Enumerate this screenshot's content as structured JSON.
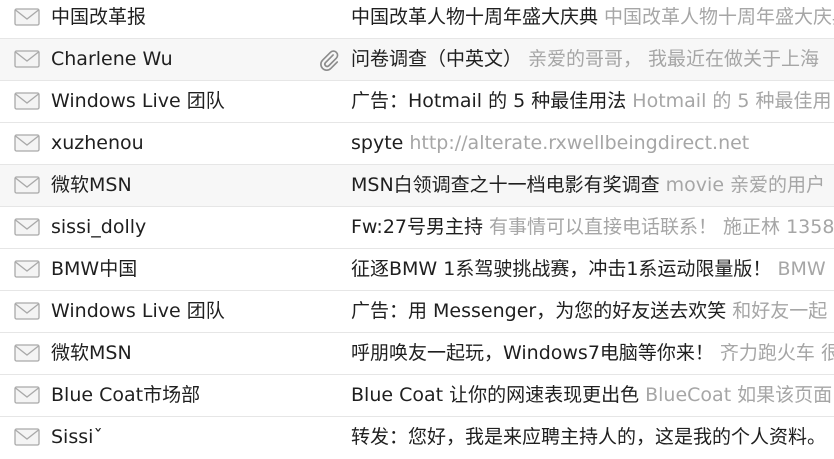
{
  "icons": {
    "envelope": "envelope-icon",
    "attachment": "paperclip-icon"
  },
  "colors": {
    "sender_text": "#1f1f1f",
    "preview_text": "#a6a6a6",
    "row_divider": "#e6e6e6"
  },
  "messages": [
    {
      "sender": "中国改革报",
      "subject": "中国改革人物十周年盛大庆典",
      "preview": "中国改革人物十周年盛大庆典",
      "has_attachment": false
    },
    {
      "sender": "Charlene Wu",
      "subject": "问卷调查（中英文）",
      "preview": "亲爱的哥哥， 我最近在做关于上海",
      "has_attachment": true
    },
    {
      "sender": "Windows Live 团队",
      "subject": "广告：Hotmail 的 5 种最佳用法",
      "preview": "Hotmail 的 5 种最佳用",
      "has_attachment": false
    },
    {
      "sender": "xuzhenou",
      "subject": "spyte",
      "preview": "http://alterate.rxwellbeingdirect.net",
      "has_attachment": false
    },
    {
      "sender": "微软MSN",
      "subject": "MSN白领调查之十一档电影有奖调查",
      "preview": "movie 亲爱的用户",
      "has_attachment": false
    },
    {
      "sender": "sissi_dolly",
      "subject": "Fw:27号男主持",
      "preview": "有事情可以直接电话联系！ 施正林 1358",
      "has_attachment": false
    },
    {
      "sender": "BMW中国",
      "subject": "征逐BMW 1系驾驶挑战赛，冲击1系运动限量版！",
      "preview": "BMW",
      "has_attachment": false
    },
    {
      "sender": "Windows Live 团队",
      "subject": "广告：用 Messenger，为您的好友送去欢笑",
      "preview": "和好友一起",
      "has_attachment": false
    },
    {
      "sender": "微软MSN",
      "subject": "呼朋唤友一起玩，Windows7电脑等你来！",
      "preview": "齐力跑火车 很",
      "has_attachment": false
    },
    {
      "sender": "Blue Coat市场部",
      "subject": "Blue Coat 让你的网速表现更出色",
      "preview": "BlueCoat 如果该页面",
      "has_attachment": false
    },
    {
      "sender": "Sissiˇ",
      "subject": "转发：您好，我是来应聘主持人的，这是我的个人资料。",
      "preview": "",
      "has_attachment": false
    }
  ]
}
